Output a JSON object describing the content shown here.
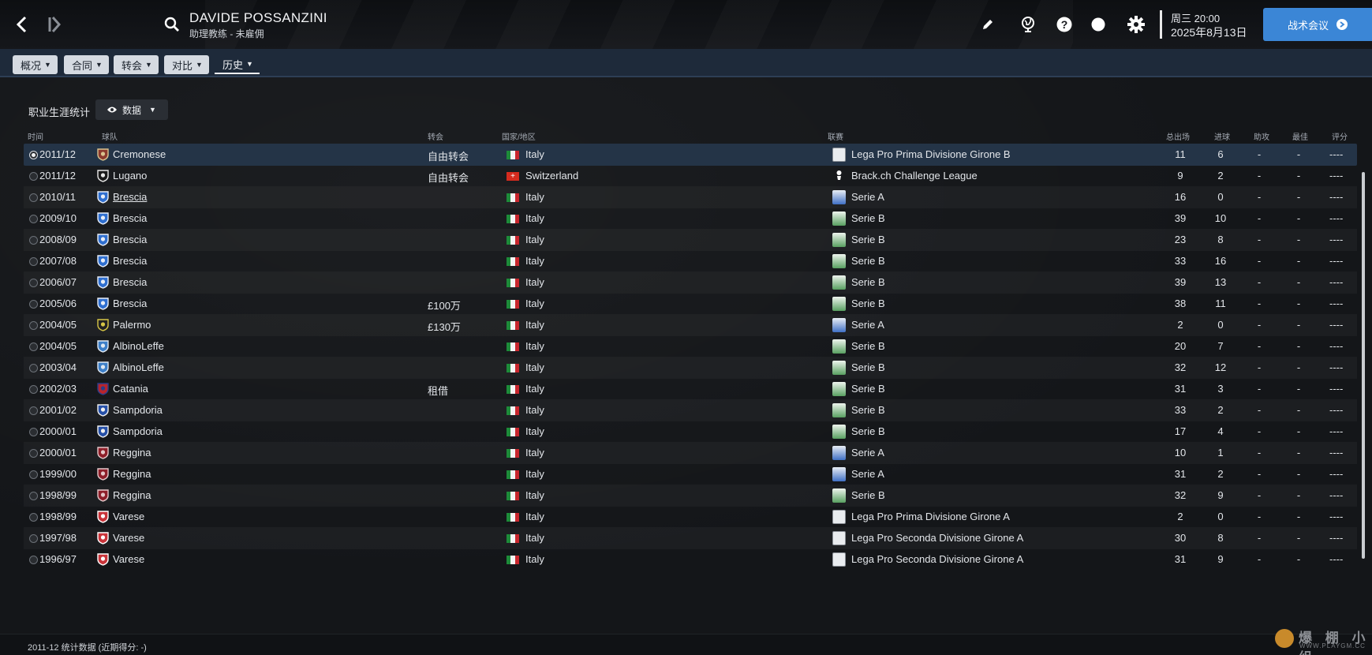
{
  "header": {
    "player_name": "DAVIDE POSSANZINI",
    "subtitle": "助理教练 - 未雇佣",
    "time": "周三 20:00",
    "date": "2025年8月13日",
    "cta_label": "战术会议",
    "icons": [
      "back-icon",
      "forward-icon",
      "search-icon",
      "pen-icon",
      "globe-icon",
      "help-icon",
      "status-dot-icon",
      "gear-icon"
    ]
  },
  "tabs": [
    {
      "label": "概况"
    },
    {
      "label": "合同"
    },
    {
      "label": "转会"
    },
    {
      "label": "对比"
    },
    {
      "label": "历史"
    }
  ],
  "section": {
    "title": "职业生涯统计",
    "view_label": "数据"
  },
  "columns": {
    "time": "时间",
    "team": "球队",
    "transfer": "转会",
    "nation": "国家/地区",
    "league": "联赛",
    "apps": "总出场",
    "goals": "进球",
    "assists": "助攻",
    "best": "最佳",
    "rating": "评分"
  },
  "rows": [
    {
      "season": "2011/12",
      "team": "Cremonese",
      "transfer": "自由转会",
      "nation": "Italy",
      "league": "Lega Pro Prima Divisione Girone B",
      "apps": "11",
      "goals": "6",
      "assists": "-",
      "best": "-",
      "rating": "----"
    },
    {
      "season": "2011/12",
      "team": "Lugano",
      "transfer": "自由转会",
      "nation": "Switzerland",
      "league": "Brack.ch Challenge League",
      "apps": "9",
      "goals": "2",
      "assists": "-",
      "best": "-",
      "rating": "----"
    },
    {
      "season": "2010/11",
      "team": "Brescia",
      "transfer": "",
      "nation": "Italy",
      "league": "Serie A",
      "apps": "16",
      "goals": "0",
      "assists": "-",
      "best": "-",
      "rating": "----"
    },
    {
      "season": "2009/10",
      "team": "Brescia",
      "transfer": "",
      "nation": "Italy",
      "league": "Serie B",
      "apps": "39",
      "goals": "10",
      "assists": "-",
      "best": "-",
      "rating": "----"
    },
    {
      "season": "2008/09",
      "team": "Brescia",
      "transfer": "",
      "nation": "Italy",
      "league": "Serie B",
      "apps": "23",
      "goals": "8",
      "assists": "-",
      "best": "-",
      "rating": "----"
    },
    {
      "season": "2007/08",
      "team": "Brescia",
      "transfer": "",
      "nation": "Italy",
      "league": "Serie B",
      "apps": "33",
      "goals": "16",
      "assists": "-",
      "best": "-",
      "rating": "----"
    },
    {
      "season": "2006/07",
      "team": "Brescia",
      "transfer": "",
      "nation": "Italy",
      "league": "Serie B",
      "apps": "39",
      "goals": "13",
      "assists": "-",
      "best": "-",
      "rating": "----"
    },
    {
      "season": "2005/06",
      "team": "Brescia",
      "transfer": "£100万",
      "nation": "Italy",
      "league": "Serie B",
      "apps": "38",
      "goals": "11",
      "assists": "-",
      "best": "-",
      "rating": "----"
    },
    {
      "season": "2004/05",
      "team": "Palermo",
      "transfer": "£130万",
      "nation": "Italy",
      "league": "Serie A",
      "apps": "2",
      "goals": "0",
      "assists": "-",
      "best": "-",
      "rating": "----"
    },
    {
      "season": "2004/05",
      "team": "AlbinoLeffe",
      "transfer": "",
      "nation": "Italy",
      "league": "Serie B",
      "apps": "20",
      "goals": "7",
      "assists": "-",
      "best": "-",
      "rating": "----"
    },
    {
      "season": "2003/04",
      "team": "AlbinoLeffe",
      "transfer": "",
      "nation": "Italy",
      "league": "Serie B",
      "apps": "32",
      "goals": "12",
      "assists": "-",
      "best": "-",
      "rating": "----"
    },
    {
      "season": "2002/03",
      "team": "Catania",
      "transfer": "租借",
      "nation": "Italy",
      "league": "Serie B",
      "apps": "31",
      "goals": "3",
      "assists": "-",
      "best": "-",
      "rating": "----"
    },
    {
      "season": "2001/02",
      "team": "Sampdoria",
      "transfer": "",
      "nation": "Italy",
      "league": "Serie B",
      "apps": "33",
      "goals": "2",
      "assists": "-",
      "best": "-",
      "rating": "----"
    },
    {
      "season": "2000/01",
      "team": "Sampdoria",
      "transfer": "",
      "nation": "Italy",
      "league": "Serie B",
      "apps": "17",
      "goals": "4",
      "assists": "-",
      "best": "-",
      "rating": "----"
    },
    {
      "season": "2000/01",
      "team": "Reggina",
      "transfer": "",
      "nation": "Italy",
      "league": "Serie A",
      "apps": "10",
      "goals": "1",
      "assists": "-",
      "best": "-",
      "rating": "----"
    },
    {
      "season": "1999/00",
      "team": "Reggina",
      "transfer": "",
      "nation": "Italy",
      "league": "Serie A",
      "apps": "31",
      "goals": "2",
      "assists": "-",
      "best": "-",
      "rating": "----"
    },
    {
      "season": "1998/99",
      "team": "Reggina",
      "transfer": "",
      "nation": "Italy",
      "league": "Serie B",
      "apps": "32",
      "goals": "9",
      "assists": "-",
      "best": "-",
      "rating": "----"
    },
    {
      "season": "1998/99",
      "team": "Varese",
      "transfer": "",
      "nation": "Italy",
      "league": "Lega Pro Prima Divisione Girone A",
      "apps": "2",
      "goals": "0",
      "assists": "-",
      "best": "-",
      "rating": "----"
    },
    {
      "season": "1997/98",
      "team": "Varese",
      "transfer": "",
      "nation": "Italy",
      "league": "Lega Pro Seconda Divisione Girone A",
      "apps": "30",
      "goals": "8",
      "assists": "-",
      "best": "-",
      "rating": "----"
    },
    {
      "season": "1996/97",
      "team": "Varese",
      "transfer": "",
      "nation": "Italy",
      "league": "Lega Pro Seconda Divisione Girone A",
      "apps": "31",
      "goals": "9",
      "assists": "-",
      "best": "-",
      "rating": "----"
    }
  ],
  "footer": {
    "text": "2011-12 统计数据 (近期得分: -)"
  },
  "watermark": {
    "title": "爆 棚 小 组",
    "url": "WWW.PLAYGM.CC"
  },
  "colors": {
    "accent": "#3b86d6",
    "selected_row": "#243447",
    "tab_bar": "#1e2a3a"
  }
}
